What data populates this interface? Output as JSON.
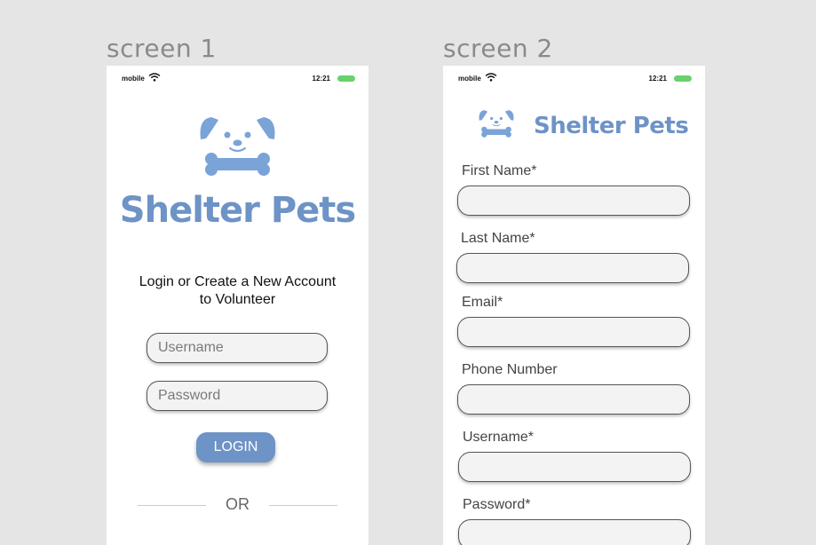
{
  "screens": [
    {
      "label": "screen 1"
    },
    {
      "label": "screen 2"
    }
  ],
  "status_bar": {
    "carrier": "mobile",
    "time": "12:21"
  },
  "brand": {
    "name": "Shelter Pets",
    "color": "#6e93c6",
    "logo_icon": "dog-with-bone-icon"
  },
  "login_screen": {
    "intro_line1": "Login or Create a New Account",
    "intro_line2": "to Volunteer",
    "username_placeholder": "Username",
    "password_placeholder": "Password",
    "login_label": "LOGIN",
    "or_label": "OR"
  },
  "signup_screen": {
    "fields": [
      {
        "label": "First Name*"
      },
      {
        "label": "Last Name*"
      },
      {
        "label": "Email*"
      },
      {
        "label": "Phone Number"
      },
      {
        "label": "Username*"
      },
      {
        "label": "Password*"
      }
    ]
  }
}
